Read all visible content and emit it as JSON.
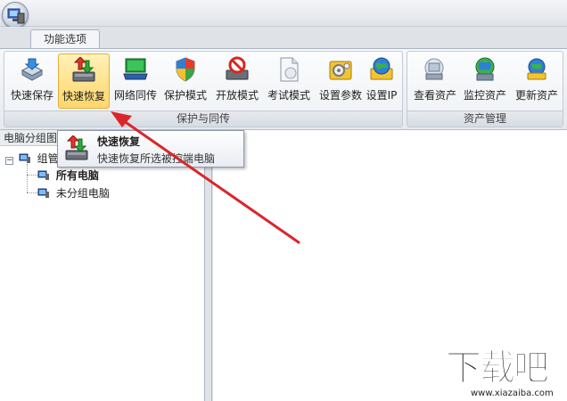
{
  "tabs": {
    "active": "功能选项"
  },
  "ribbon": {
    "groups": [
      {
        "label": "保护与同传",
        "buttons": [
          "快速保存",
          "快速恢复",
          "网络同传",
          "保护模式",
          "开放模式",
          "考试模式",
          "设置参数",
          "设置IP"
        ]
      },
      {
        "label": "资产管理",
        "buttons": [
          "查看资产",
          "监控资产",
          "更新资产"
        ]
      }
    ],
    "active_button": "快速恢复"
  },
  "left_panel": {
    "header": "电脑分组图",
    "tree": {
      "root": "组管",
      "children": [
        "所有电脑",
        "未分组电脑"
      ]
    }
  },
  "tooltip": {
    "title": "快速恢复",
    "description": "快速恢复所选被控端电脑"
  },
  "watermark": {
    "main": "下载吧",
    "sub": "www.xiazaiba.com"
  },
  "colors": {
    "active_button": "#ffd66b",
    "arrow": "#d9262c",
    "ribbon_bg": "#e6e9ee"
  }
}
